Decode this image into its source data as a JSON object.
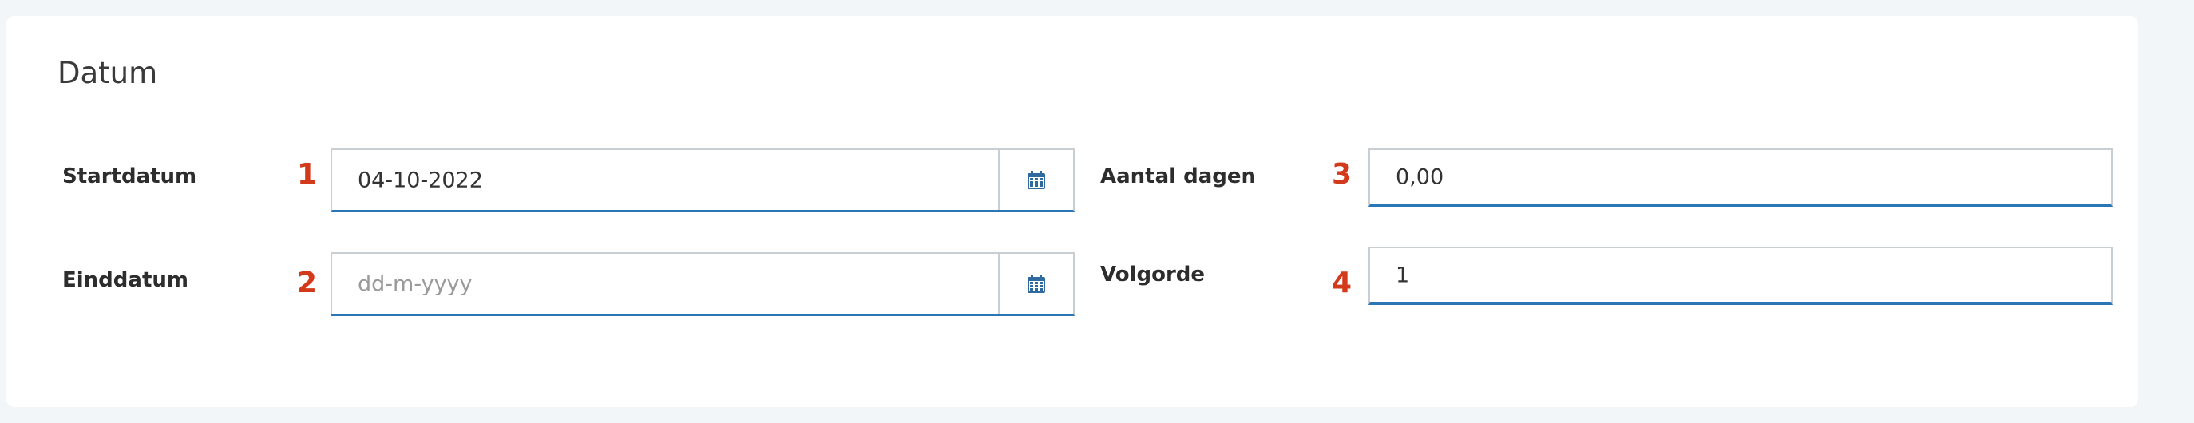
{
  "section": {
    "title": "Datum"
  },
  "fields": {
    "startdatum": {
      "label": "Startdatum",
      "number": "1",
      "value": "04-10-2022",
      "placeholder": ""
    },
    "einddatum": {
      "label": "Einddatum",
      "number": "2",
      "value": "",
      "placeholder": "dd-m-yyyy"
    },
    "aantal_dagen": {
      "label": "Aantal dagen",
      "number": "3",
      "value": "0,00"
    },
    "volgorde": {
      "label": "Volgorde",
      "number": "4",
      "value": "1"
    }
  },
  "icons": {
    "calendar": "calendar-icon"
  },
  "colors": {
    "accent": "#2b77b5",
    "number_marker": "#d33a1b",
    "icon": "#2f6a9e"
  }
}
